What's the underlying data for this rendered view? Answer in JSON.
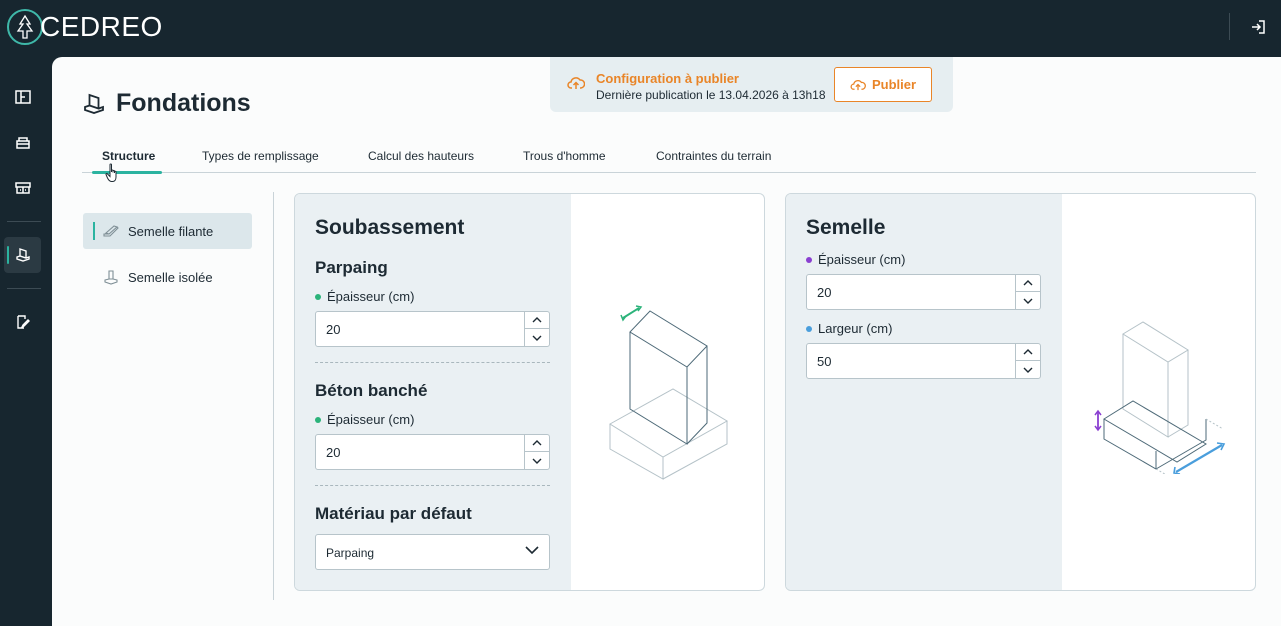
{
  "app": {
    "brand": "CEDREO",
    "colors": {
      "accent": "#2bb3a0",
      "publish": "#e98528",
      "dark": "#17262f",
      "dot_green": "#2bb37a",
      "dot_purple": "#8a3fd1",
      "dot_blue": "#4a9edc"
    }
  },
  "topbar": {
    "logout_icon": "logout-icon"
  },
  "sidebar": {
    "items": [
      {
        "name": "floorplan",
        "icon": "floorplan-icon"
      },
      {
        "name": "furniture",
        "icon": "furniture-icon"
      },
      {
        "name": "kitchen",
        "icon": "kitchen-icon"
      },
      {
        "name": "foundations",
        "icon": "foundations-icon",
        "active": true
      },
      {
        "name": "edit-document",
        "icon": "edit-document-icon"
      }
    ]
  },
  "publish": {
    "title": "Configuration à publier",
    "subtitle": "Dernière publication le 13.04.2026 à 13h18",
    "button_label": "Publier"
  },
  "page": {
    "title": "Fondations"
  },
  "tabs": [
    {
      "label": "Structure",
      "active": true
    },
    {
      "label": "Types de remplissage"
    },
    {
      "label": "Calcul des hauteurs"
    },
    {
      "label": "Trous d'homme"
    },
    {
      "label": "Contraintes du terrain"
    }
  ],
  "subnav": [
    {
      "label": "Semelle filante",
      "active": true
    },
    {
      "label": "Semelle isolée"
    }
  ],
  "soubassement": {
    "title": "Soubassement",
    "parpaing": {
      "title": "Parpaing",
      "label": "Épaisseur (cm)",
      "value": "20"
    },
    "beton": {
      "title": "Béton banché",
      "label": "Épaisseur (cm)",
      "value": "20"
    },
    "materiau": {
      "title": "Matériau par défaut",
      "value": "Parpaing"
    }
  },
  "semelle": {
    "title": "Semelle",
    "epaisseur": {
      "label": "Épaisseur (cm)",
      "value": "20"
    },
    "largeur": {
      "label": "Largeur (cm)",
      "value": "50"
    }
  }
}
